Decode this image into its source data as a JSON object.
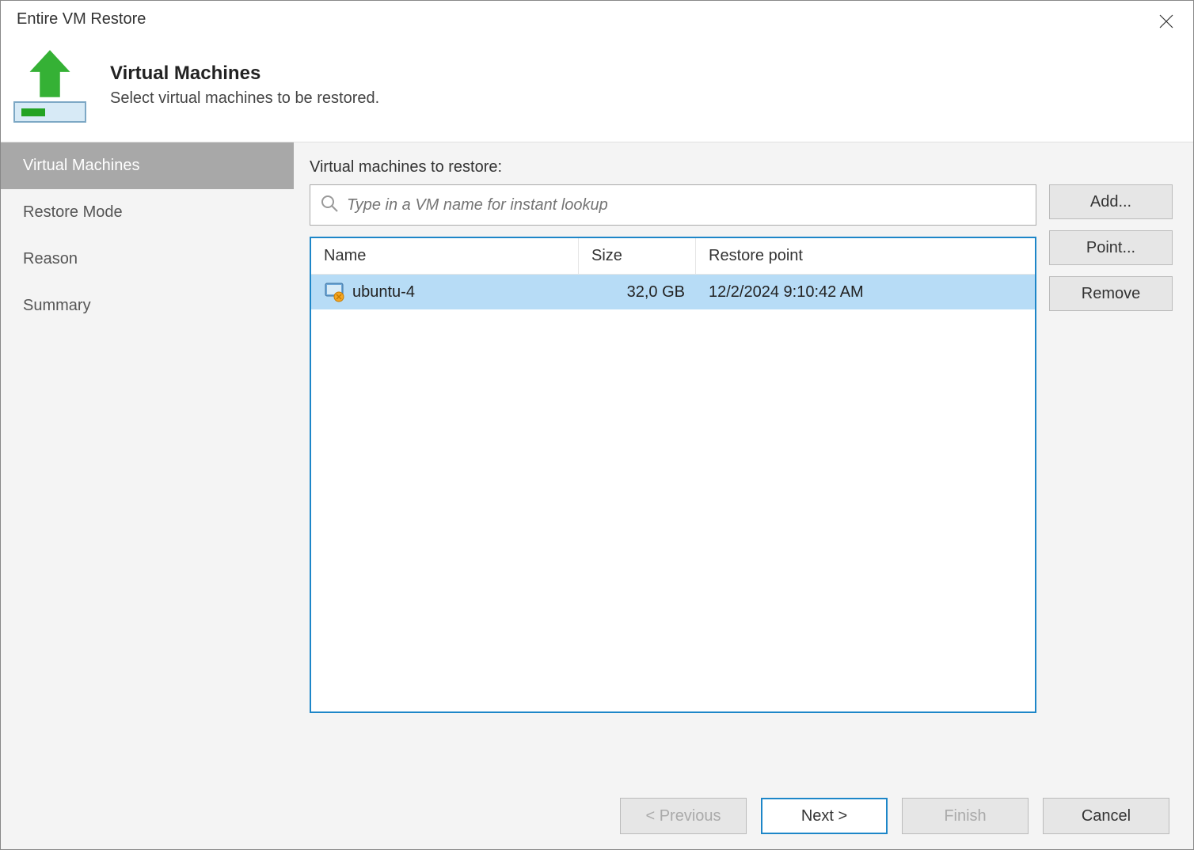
{
  "window": {
    "title": "Entire VM Restore"
  },
  "header": {
    "heading": "Virtual Machines",
    "subheading": "Select virtual machines to be restored."
  },
  "sidebar": {
    "items": [
      {
        "label": "Virtual Machines",
        "active": true
      },
      {
        "label": "Restore Mode",
        "active": false
      },
      {
        "label": "Reason",
        "active": false
      },
      {
        "label": "Summary",
        "active": false
      }
    ]
  },
  "main": {
    "label": "Virtual machines to restore:",
    "search_placeholder": "Type in a VM name for instant lookup",
    "columns": {
      "name": "Name",
      "size": "Size",
      "point": "Restore point"
    },
    "rows": [
      {
        "name": "ubuntu-4",
        "size": "32,0 GB",
        "point": "12/2/2024 9:10:42 AM"
      }
    ],
    "buttons": {
      "add": "Add...",
      "point": "Point...",
      "remove": "Remove"
    }
  },
  "footer": {
    "previous": "< Previous",
    "next": "Next >",
    "finish": "Finish",
    "cancel": "Cancel"
  }
}
